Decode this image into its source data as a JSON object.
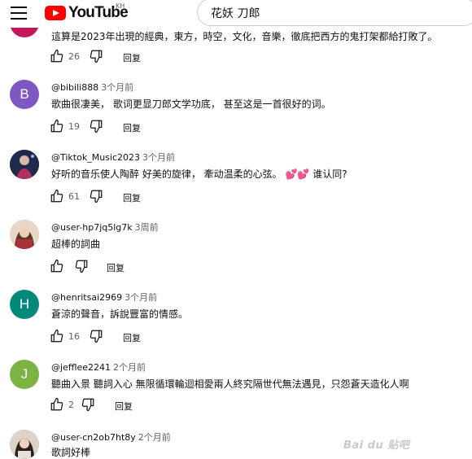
{
  "header": {
    "logo_text": "YouTube",
    "region": "KH",
    "search_value": "花妖 刀郎"
  },
  "partial_comment": {
    "text": "這算是2023年出現的經典，東方，時空，文化，音樂，徹底把西方的鬼打架都給打敗了。",
    "likes": "26",
    "reply": "回复"
  },
  "comments": [
    {
      "avatar_letter": "B",
      "avatar_color": "#7e57c2",
      "author": "@bibili888",
      "time": "3个月前",
      "text": "歌曲很凄美，  歌词更显刀郎文学功底，  甚至这是一首很好的词。",
      "likes": "19",
      "reply": "回复"
    },
    {
      "avatar_letter": "",
      "avatar_color": "#2a3558",
      "author": "@Tiktok_Music2023",
      "time": "3个月前",
      "text_before": "好听的音乐使人陶醉 好美的旋律，  牽动温柔的心弦。",
      "hearts": "💕💕",
      "text_after": "谁认同?",
      "likes": "61",
      "reply": "回复"
    },
    {
      "avatar_letter": "",
      "avatar_color": "#c9a58a",
      "author": "@user-hp7jq5lg7k",
      "time": "3周前",
      "text": "超棒的詞曲",
      "likes": "",
      "reply": "回复"
    },
    {
      "avatar_letter": "H",
      "avatar_color": "#00897b",
      "author": "@henritsai2969",
      "time": "3个月前",
      "text": "蒼涼的聲音，訴說豐富的情感。",
      "likes": "16",
      "reply": "回复"
    },
    {
      "avatar_letter": "J",
      "avatar_color": "#7cb342",
      "author": "@jefflee2241",
      "time": "2个月前",
      "text": "聽曲入景 聽詞入心 無限循環輪迴相愛兩人終究隔世代無法遇見，只怨蒼天造化人啊",
      "likes": "2",
      "reply": "回复"
    },
    {
      "avatar_letter": "",
      "avatar_color": "#b9a393",
      "author": "@user-cn2ob7ht8y",
      "time": "2个月前",
      "text": "歌詞好棒",
      "likes": "",
      "reply": ""
    }
  ],
  "watermark": "Bai du 贴吧"
}
